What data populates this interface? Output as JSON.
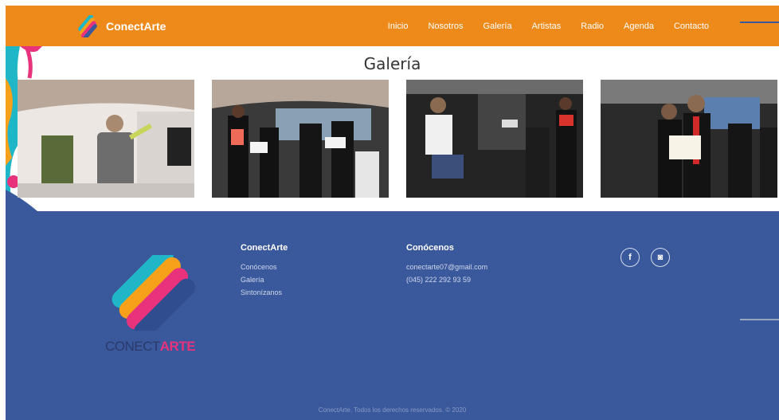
{
  "header": {
    "brand_name": "ConectArte",
    "logo_icon": "conectarte-logo-icon",
    "nav": [
      "Inicio",
      "Nosotros",
      "Galería",
      "Artistas",
      "Radio",
      "Agenda",
      "Contacto"
    ]
  },
  "gallery": {
    "title": "Galería",
    "photos": [
      {
        "icon": "photo-singer-with-microphone"
      },
      {
        "icon": "photo-choir-with-music-stands"
      },
      {
        "icon": "photo-musicians-performing"
      },
      {
        "icon": "photo-certificate-award"
      }
    ]
  },
  "footer": {
    "logo_text_a": "CONECT",
    "logo_text_b": "ARTE",
    "col1": {
      "title": "ConectArte",
      "links": [
        "Conócenos",
        "Galería",
        "Sintonízanos"
      ]
    },
    "col2": {
      "title": "Conócenos",
      "email": "conectarte07@gmail.com",
      "phone": "(045) 222 292 93 59"
    },
    "social": {
      "facebook": "f",
      "instagram": "◙"
    },
    "copyright": "ConectArte. Todos los derechos reservados. © 2020"
  },
  "colors": {
    "header_bg": "#ee8a1a",
    "footer_bg": "#3a589c",
    "accent_pink": "#e8327c"
  }
}
